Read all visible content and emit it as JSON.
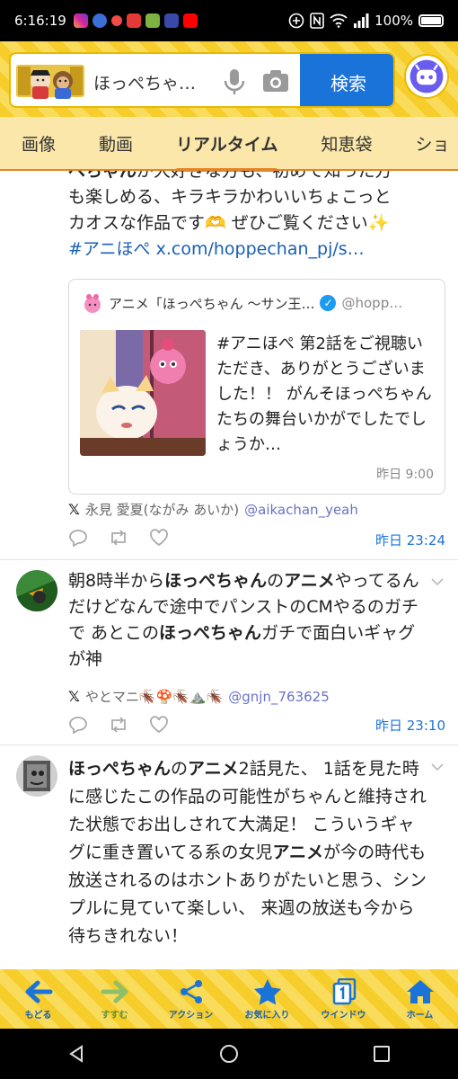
{
  "status_bar": {
    "time": "6:16:19",
    "battery": "100%"
  },
  "search": {
    "query": "ほっぺちゃ…",
    "button_label": "検索"
  },
  "tabs": [
    {
      "label": "画像"
    },
    {
      "label": "動画"
    },
    {
      "label": "リアルタイム"
    },
    {
      "label": "知恵袋"
    },
    {
      "label": "ショ"
    }
  ],
  "active_tab": "リアルタイム",
  "post1": {
    "line1_bold": "ぺちゃん",
    "line1_rest": "が大好きな方も、初めて知った方",
    "line2": "も楽しめる、キラキラかわいいちょこっと",
    "line3": "カオスな作品です🫶 ぜひご覧ください✨",
    "hashtag": "#アニほぺ",
    "link": "x.com/hoppechan_pj/s…",
    "embed": {
      "account_name": "アニメ「ほっぺちゃん ～サン王…",
      "account_handle": "@hopp…",
      "body": "#アニほぺ 第2話をご視聴いただき、ありがとうございました！！ がんそほっぺちゃんたちの舞台いかがでしたでしょうか…",
      "time": "昨日 9:00"
    },
    "source_name": "永見 愛夏(ながみ あいか)",
    "source_handle": "@aikachan_yeah",
    "time": "昨日 23:24"
  },
  "post2": {
    "seg1": "朝8時半から",
    "seg2": "ほっぺちゃん",
    "seg3": "の",
    "seg4": "アニメ",
    "seg5": "やってるんだけどなんで途中でパンストのCMやるのガチで あとこの",
    "seg6": "ほっぺちゃん",
    "seg7": "ガチで面白いギャグが神",
    "source_name": "やとマニ🪳🍄🪳⛰️🪳",
    "source_handle": "@gnjn_763625",
    "time": "昨日 23:10"
  },
  "post3": {
    "seg1": "ほっぺちゃん",
    "seg2": "の",
    "seg3": "アニメ",
    "seg4": "2話見た、 1話を見た時に感じたこの作品の可能性がちゃんと維持された状態でお出しされて大満足！ こういうギャグに重き置いてる系の女児",
    "seg5": "アニメ",
    "seg6": "が今の時代も放送されるのはホントありがたいと思う、シンプルに見ていて楽しい、 来週の放送も今から待ちきれない！"
  },
  "toolbar": [
    {
      "label": "もどる",
      "icon": "back-arrow-icon"
    },
    {
      "label": "すすむ",
      "icon": "forward-arrow-icon"
    },
    {
      "label": "アクション",
      "icon": "share-icon"
    },
    {
      "label": "お気に入り",
      "icon": "star-icon"
    },
    {
      "label": "ウインドウ",
      "icon": "window-icon"
    },
    {
      "label": "ホーム",
      "icon": "home-icon"
    }
  ],
  "colors": {
    "brand_yellow": "#f6cd2a",
    "search_blue": "#1a73d9",
    "tab_accent": "#e2852c",
    "link_blue": "#1a5fb4"
  }
}
